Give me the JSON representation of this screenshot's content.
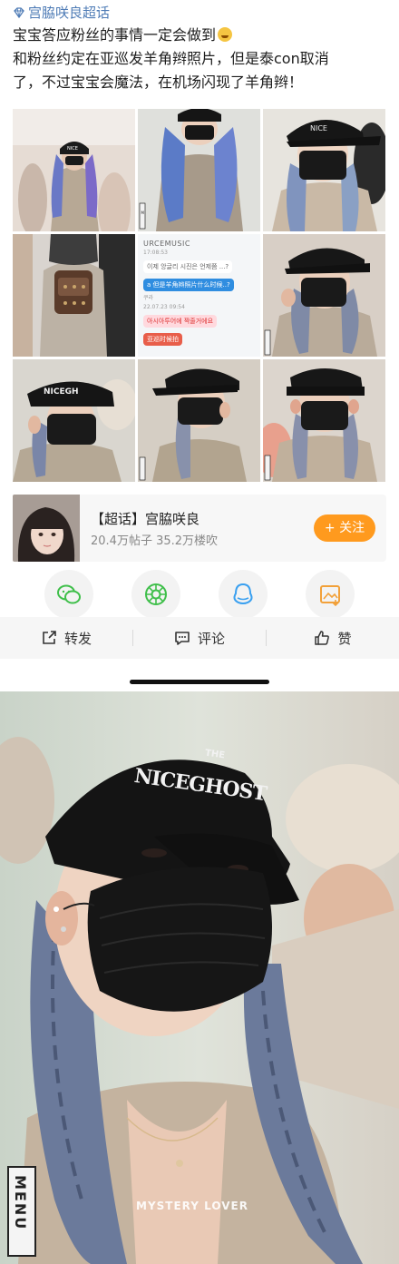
{
  "post": {
    "topic_tag": "宫脇咲良超话",
    "lines": [
      "宝宝答应粉丝的事情一定会做到",
      "和粉丝约定在亚巡发羊角辫照片，但是泰con取消",
      "了，不过宝宝会魔法，在机场闪现了羊角辫！"
    ]
  },
  "grid_images": [
    {
      "name": "photo-1",
      "desc_icon": "image"
    },
    {
      "name": "photo-2",
      "desc_icon": "image"
    },
    {
      "name": "photo-3",
      "desc_icon": "image"
    },
    {
      "name": "photo-4",
      "desc_icon": "image"
    },
    {
      "name": "photo-5-chat",
      "desc_icon": "image"
    },
    {
      "name": "photo-6",
      "desc_icon": "image"
    },
    {
      "name": "photo-7",
      "desc_icon": "image"
    },
    {
      "name": "photo-8",
      "desc_icon": "image"
    },
    {
      "name": "photo-9",
      "desc_icon": "image"
    }
  ],
  "chat_screenshot": {
    "source": "URCEMUSIC",
    "time1": "17:08:53",
    "bubble1": "이제 앙글리 시진은 언제쯤 ...?",
    "bubble2": "a 但是羊角辫照片什么时候..?",
    "sender": "쿠라",
    "time2": "22.07.23 09:54",
    "bubble3": "아시아투어에 짝줄거에요",
    "bubble4": "亚巡时候拍"
  },
  "topic_card": {
    "name": "【超话】宫脇咲良",
    "stats": "20.4万帖子  35.2万楼吹",
    "follow_label": "+ 关注"
  },
  "share_icons": [
    "wechat-icon",
    "moments-icon",
    "qq-icon",
    "save-image-icon"
  ],
  "actions": {
    "repost": "转发",
    "comment": "评论",
    "like": "赞"
  },
  "big_photo": {
    "cap_text": "NICEGHOST",
    "cap_subtext": "THE",
    "watermark": "MYSTERY LOVER",
    "menu_tag": "MENU"
  },
  "colors": {
    "topic_blue": "#4f7cb6",
    "follow_orange": "#ff9a1e",
    "action_bar_bg": "#f6f6f6"
  }
}
